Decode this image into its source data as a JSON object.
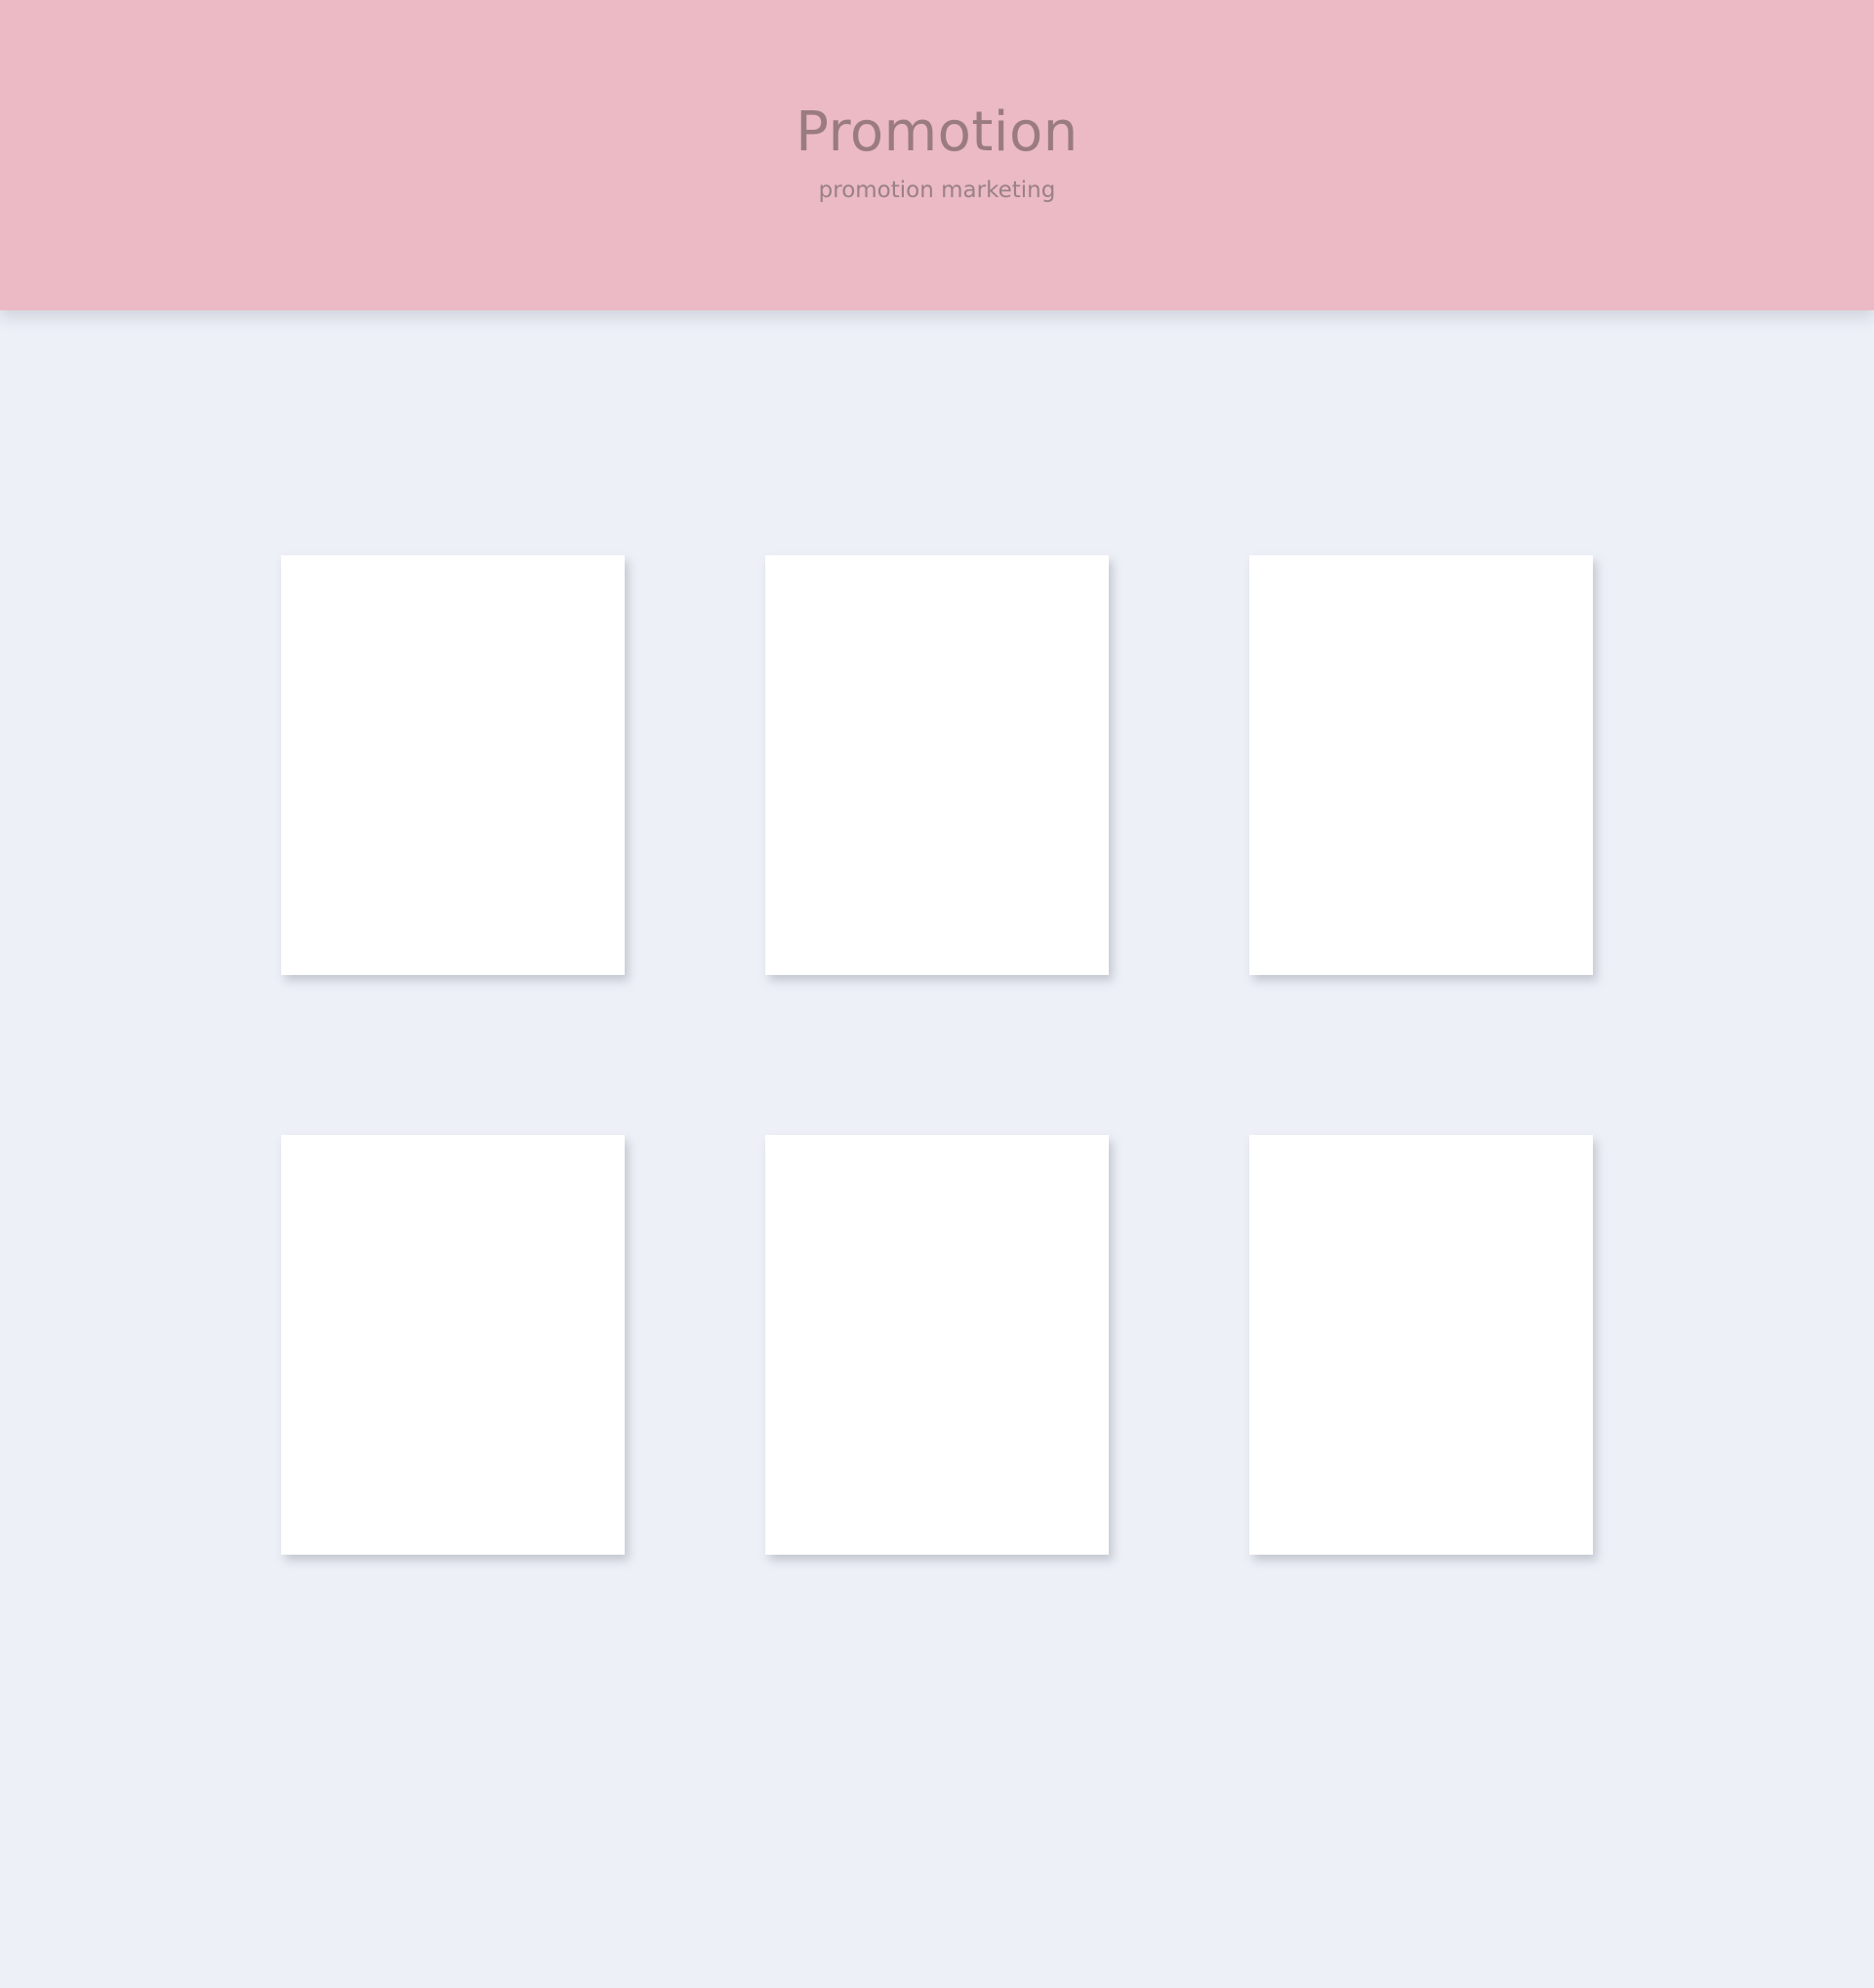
{
  "header": {
    "title": "Promotion",
    "subtitle": "promotion marketing",
    "background_color": "#ebbac5",
    "text_color": "#9a7b80"
  },
  "main": {
    "background_color": "#edf0f7",
    "cards": [
      {
        "id": 1
      },
      {
        "id": 2
      },
      {
        "id": 3
      },
      {
        "id": 4
      },
      {
        "id": 5
      },
      {
        "id": 6
      }
    ]
  }
}
